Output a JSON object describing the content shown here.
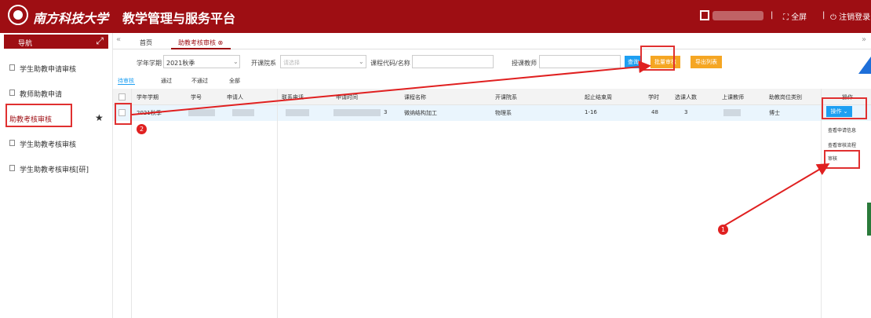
{
  "header": {
    "school_name": "南方科技大学",
    "platform_name": "教学管理与服务平台",
    "fullscreen_label": "全屏",
    "logout_label": "注销登录",
    "brand_color": "#9e0e13"
  },
  "sidebar": {
    "title": "导航",
    "items": [
      {
        "label": "学生助教申请审核"
      },
      {
        "label": "教师助教申请"
      },
      {
        "label": "助教考核审核"
      },
      {
        "label": "学生助教考核审核"
      },
      {
        "label": "学生助教考核审核[研]"
      }
    ]
  },
  "tabs": [
    {
      "label": "首页"
    },
    {
      "label": "助教考核审核"
    }
  ],
  "filters": {
    "term_label": "学年学期",
    "term_value": "2021秋季",
    "dept_label": "开课院系",
    "dept_placeholder": "请选择",
    "course_label": "课程代码/名称",
    "teacher_label": "授课教师"
  },
  "buttons": {
    "search": "查询",
    "batch_review": "批量审核",
    "export": "导出列表"
  },
  "status_tabs": [
    "待审核",
    "通过",
    "不通过",
    "全部"
  ],
  "table": {
    "headers": [
      "学年学期",
      "学号",
      "申请人",
      "联系电话",
      "申请时间",
      "课程名称",
      "开课院系",
      "起止结束周",
      "学时",
      "选课人数",
      "上课教师",
      "助教岗位类别",
      "操作"
    ],
    "rows": [
      {
        "term": "2021秋季",
        "apply_tail": "3",
        "course": "微纳结构加工",
        "dept": "物理系",
        "weeks": "1-16",
        "hours": "48",
        "enrolled": "3",
        "category": "博士"
      }
    ]
  },
  "operation": {
    "button": "操作",
    "menu": [
      "查看申请信息",
      "查看审核流程",
      "审核"
    ]
  },
  "markers": [
    "1",
    "2"
  ]
}
